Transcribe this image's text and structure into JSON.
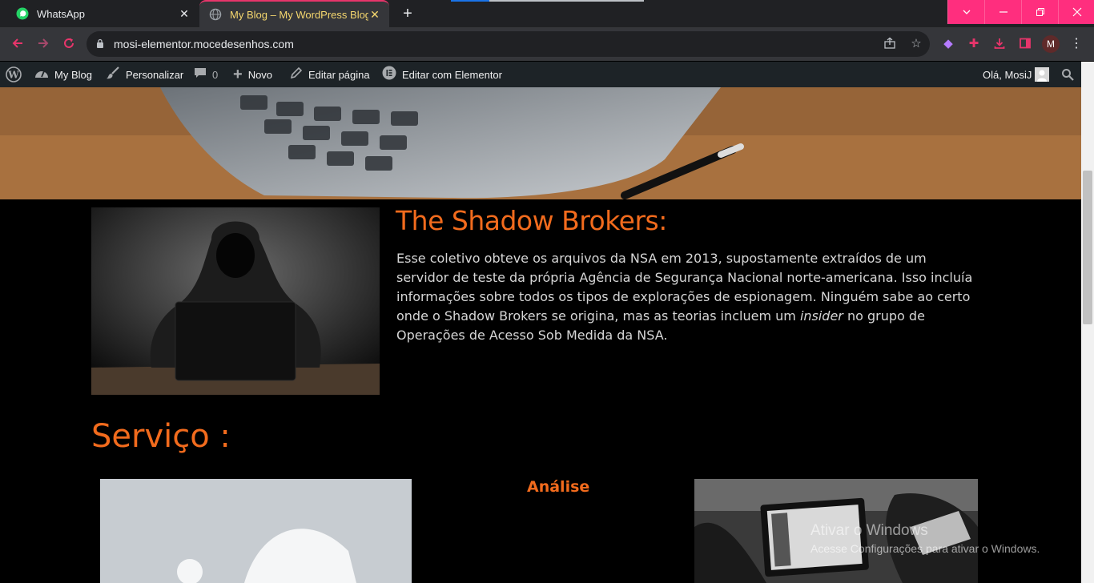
{
  "browser": {
    "tabs": [
      {
        "title": "WhatsApp",
        "active": false
      },
      {
        "title": "My Blog – My WordPress Blog",
        "active": true
      }
    ],
    "url": "mosi-elementor.mocedesenhos.com",
    "profile_initial": "M"
  },
  "adminbar": {
    "site_name": "My Blog",
    "customize": "Personalizar",
    "comments_count": "0",
    "new": "Novo",
    "edit_page": "Editar página",
    "edit_elementor": "Editar com Elementor",
    "greeting": "Olá, MosiJ"
  },
  "content": {
    "title": "The Shadow Brokers:",
    "paragraph_before": "Esse coletivo obteve os arquivos da NSA em 2013, supostamente extraídos de um servidor de teste da própria Agência de Segurança Nacional norte-americana. Isso incluía informações sobre todos os tipos de explorações de espionagem. Ninguém sabe ao certo onde o Shadow Brokers se origina, mas as teorias incluem um",
    "paragraph_em": "insider",
    "paragraph_after": "no grupo de Operações de Acesso Sob Medida da NSA.",
    "services_heading": "Serviço :",
    "service_analysis": "Análise"
  },
  "watermark": {
    "line1": "Ativar o Windows",
    "line2": "Acesse Configurações para ativar o Windows."
  },
  "colors": {
    "accent": "#f26b1d",
    "tab_accent": "#e8356b",
    "window_controls": "#ff2e7e"
  }
}
